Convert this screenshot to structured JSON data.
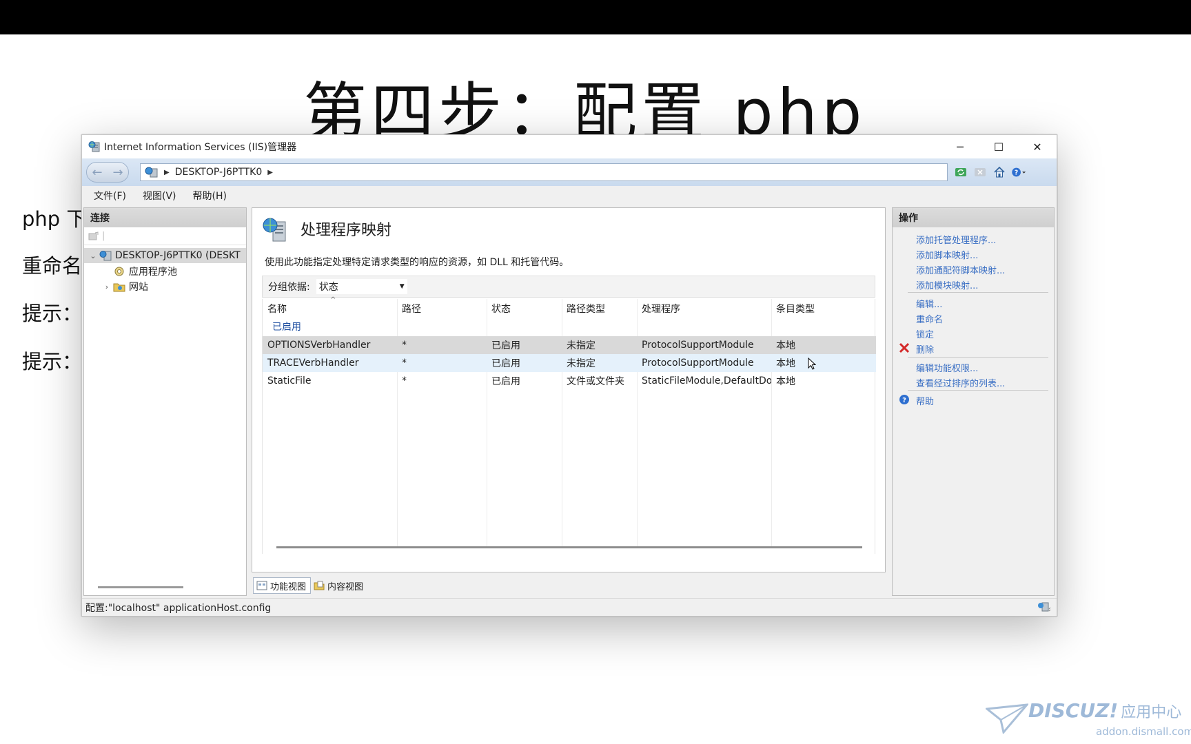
{
  "slide": {
    "title": "第四步：配置 php",
    "bg_lines": [
      "php 下",
      "重命名",
      "提示：",
      "提示："
    ]
  },
  "window": {
    "title": "Internet Information Services (IIS)管理器",
    "controls": {
      "minimize": "─",
      "maximize": "☐",
      "close": "✕"
    },
    "address": {
      "server": "DESKTOP-J6PTTK0"
    },
    "menu": [
      "文件(F)",
      "视图(V)",
      "帮助(H)"
    ],
    "status": "配置:\"localhost\" applicationHost.config"
  },
  "connections": {
    "header": "连接",
    "tree": [
      {
        "label": "DESKTOP-J6PTTK0 (DESKT",
        "expander": "⌄"
      },
      {
        "label": "应用程序池",
        "expander": ""
      },
      {
        "label": "网站",
        "expander": "›"
      }
    ]
  },
  "feature": {
    "title": "处理程序映射",
    "description": "使用此功能指定处理特定请求类型的响应的资源，如 DLL 和托管代码。",
    "group_by_label": "分组依据:",
    "group_by_value": "状态",
    "columns": [
      "名称",
      "路径",
      "状态",
      "路径类型",
      "处理程序",
      "条目类型"
    ],
    "group_name": "已启用",
    "rows": [
      {
        "name": "OPTIONSVerbHandler",
        "path": "*",
        "state": "已启用",
        "path_type": "未指定",
        "handler": "ProtocolSupportModule",
        "entry_type": "本地"
      },
      {
        "name": "TRACEVerbHandler",
        "path": "*",
        "state": "已启用",
        "path_type": "未指定",
        "handler": "ProtocolSupportModule",
        "entry_type": "本地"
      },
      {
        "name": "StaticFile",
        "path": "*",
        "state": "已启用",
        "path_type": "文件或文件夹",
        "handler": "StaticFileModule,DefaultDo...",
        "entry_type": "本地"
      }
    ],
    "tabs": [
      "功能视图",
      "内容视图"
    ]
  },
  "actions": {
    "header": "操作",
    "items": [
      "添加托管处理程序...",
      "添加脚本映射...",
      "添加通配符脚本映射...",
      "添加模块映射...",
      "编辑...",
      "重命名",
      "锁定",
      "删除",
      "编辑功能权限...",
      "查看经过排序的列表...",
      "帮助"
    ]
  },
  "watermark": {
    "brand": "DISCUZ!",
    "brand_cn": "应用中心",
    "url": "addon.dismall.com"
  }
}
